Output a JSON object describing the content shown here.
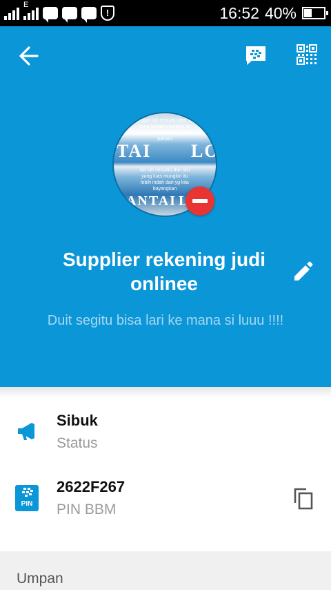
{
  "status_bar": {
    "time": "16:52",
    "battery": "40%",
    "battery_level": 0.4,
    "signal_label": "E",
    "icons": [
      "signal-icon",
      "signal-data-icon",
      "bbm-notification-icon",
      "bbm-notification-icon",
      "bbm-notification-icon",
      "shield-alert-icon"
    ]
  },
  "toolbar": {
    "back_icon": "back-arrow-icon",
    "chat_icon": "bbm-chat-icon",
    "qr_icon": "qr-code-icon"
  },
  "profile": {
    "avatar_text": {
      "line_top": "Jangan lah sesuatu dari sisi yang sempit mungkin itu bisa membuat kita salah paham",
      "word_left": "TAI",
      "word_right": "LO",
      "line_mid": "liat lah sesuatu dari sisi yang luas mungkin itu lebih indah dari yg kita bayangkan",
      "word_bottom_left": "ANTAI",
      "word_bottom_right": "LO"
    },
    "name": "Supplier rekening judi onlinee",
    "status_message": "Duit segitu bisa lari ke mana si luuu !!!!",
    "edit_icon": "pencil-icon",
    "remove_icon": "remove-minus-icon"
  },
  "info": {
    "status": {
      "value": "Sibuk",
      "label": "Status",
      "icon": "megaphone-icon"
    },
    "pin": {
      "value": "2622F267",
      "label": "PIN BBM",
      "icon": "bbm-pin-icon",
      "icon_text": "PIN",
      "copy_icon": "copy-icon"
    }
  },
  "feed": {
    "label": "Umpan"
  },
  "colors": {
    "header_bg": "#0b96d8",
    "accent": "#0b96d8",
    "remove": "#e93434"
  }
}
